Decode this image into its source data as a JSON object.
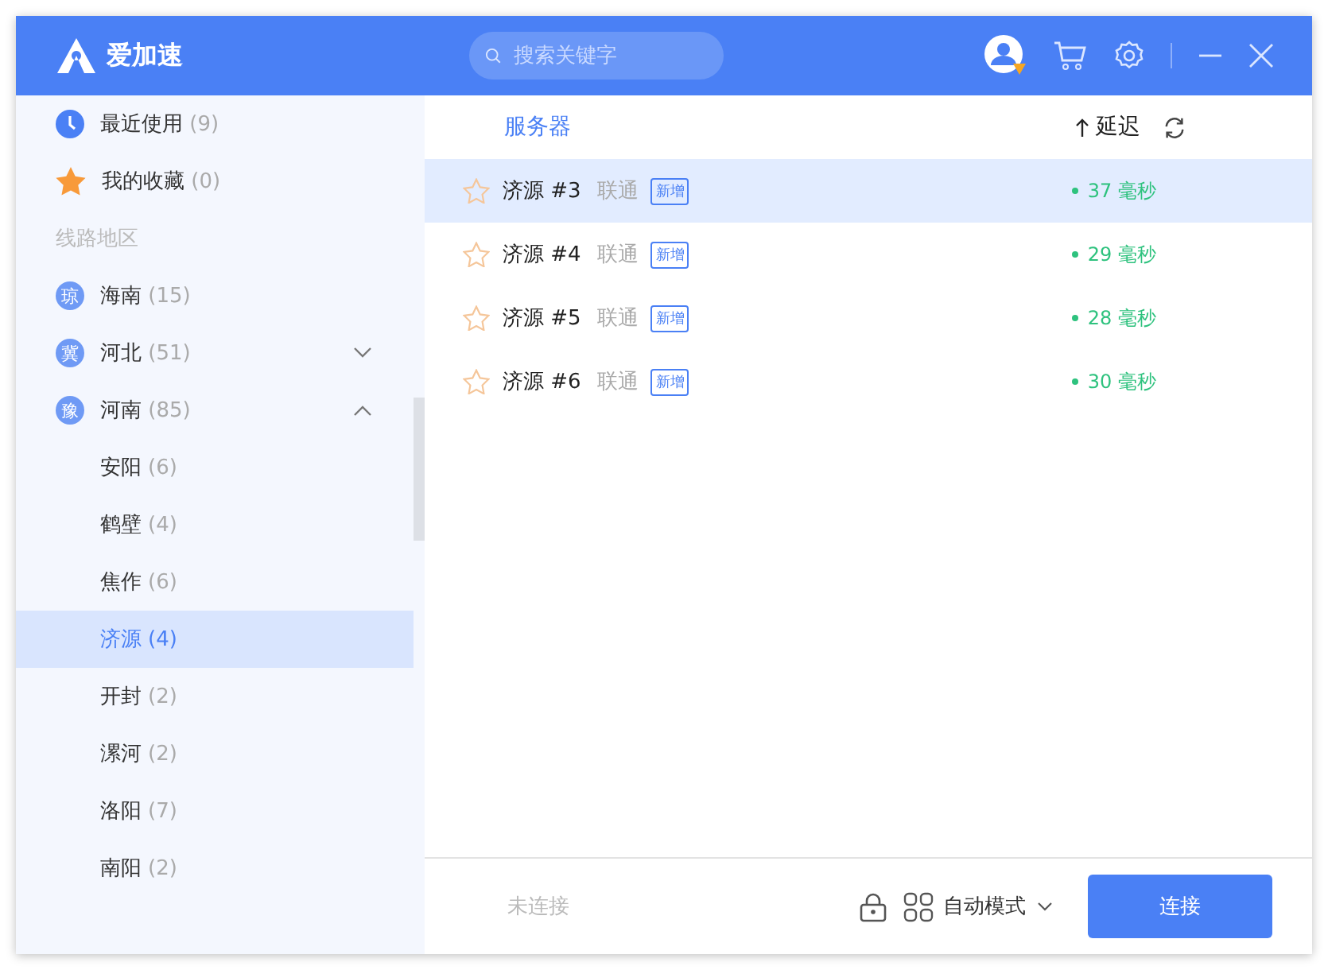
{
  "app": {
    "name": "爱加速"
  },
  "search": {
    "placeholder": "搜索关键字"
  },
  "sidebar": {
    "top_items": [
      {
        "kind": "recent",
        "label": "最近使用",
        "count": "(9)"
      },
      {
        "kind": "favorite",
        "label": "我的收藏",
        "count": "(0)"
      }
    ],
    "section_label": "线路地区",
    "regions": [
      {
        "badge": "琼",
        "label": "海南",
        "count": "(15)"
      },
      {
        "badge": "冀",
        "label": "河北",
        "count": "(51)",
        "expanded": false
      },
      {
        "badge": "豫",
        "label": "河南",
        "count": "(85)",
        "expanded": true,
        "children": [
          {
            "label": "安阳",
            "count": "(6)",
            "selected": false
          },
          {
            "label": "鹤壁",
            "count": "(4)",
            "selected": false
          },
          {
            "label": "焦作",
            "count": "(6)",
            "selected": false
          },
          {
            "label": "济源",
            "count": "(4)",
            "selected": true
          },
          {
            "label": "开封",
            "count": "(2)",
            "selected": false
          },
          {
            "label": "漯河",
            "count": "(2)",
            "selected": false
          },
          {
            "label": "洛阳",
            "count": "(7)",
            "selected": false
          },
          {
            "label": "南阳",
            "count": "(2)",
            "selected": false
          }
        ]
      }
    ]
  },
  "server_list": {
    "columns": {
      "name": "服务器",
      "latency": "延迟"
    },
    "rows": [
      {
        "favorite": false,
        "name": "济源 #3",
        "isp": "联通",
        "tag": "新增",
        "latency": "37 毫秒",
        "selected": true
      },
      {
        "favorite": false,
        "name": "济源 #4",
        "isp": "联通",
        "tag": "新增",
        "latency": "29 毫秒",
        "selected": false
      },
      {
        "favorite": false,
        "name": "济源 #5",
        "isp": "联通",
        "tag": "新增",
        "latency": "28 毫秒",
        "selected": false
      },
      {
        "favorite": false,
        "name": "济源 #6",
        "isp": "联通",
        "tag": "新增",
        "latency": "30 毫秒",
        "selected": false
      }
    ]
  },
  "footer": {
    "status": "未连接",
    "mode": "自动模式",
    "button": "连接"
  }
}
